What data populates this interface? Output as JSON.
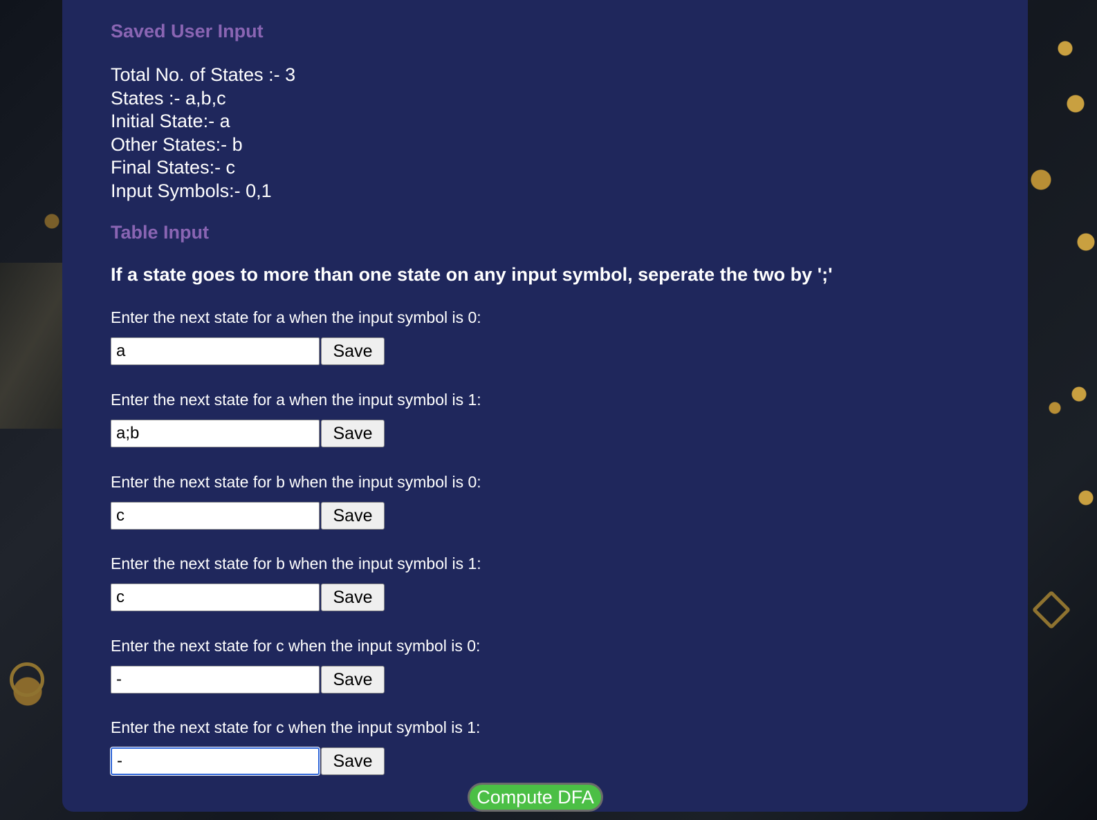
{
  "saved": {
    "title": "Saved User Input",
    "lines": [
      "Total No. of States :- 3",
      "States :- a,b,c",
      "Initial State:- a",
      "Other States:- b",
      "Final States:- c",
      "Input Symbols:- 0,1"
    ]
  },
  "table": {
    "title": "Table Input",
    "note": "If a state goes to more than one state on any input symbol, seperate the two by ';'",
    "rows": [
      {
        "label": "Enter the next state for a when the input symbol is 0:",
        "value": "a",
        "button": "Save"
      },
      {
        "label": "Enter the next state for a when the input symbol is 1:",
        "value": "a;b",
        "button": "Save"
      },
      {
        "label": "Enter the next state for b when the input symbol is 0:",
        "value": "c",
        "button": "Save"
      },
      {
        "label": "Enter the next state for b when the input symbol is 1:",
        "value": "c",
        "button": "Save"
      },
      {
        "label": "Enter the next state for c when the input symbol is 0:",
        "value": "-",
        "button": "Save"
      },
      {
        "label": "Enter the next state for c when the input symbol is 1:",
        "value": "-",
        "button": "Save"
      }
    ]
  },
  "compute_button": "Compute DFA",
  "colors": {
    "panel": "#1f275c",
    "section_title": "#8a65b3",
    "compute": "#4bbf45",
    "focus": "#2f66d8"
  }
}
